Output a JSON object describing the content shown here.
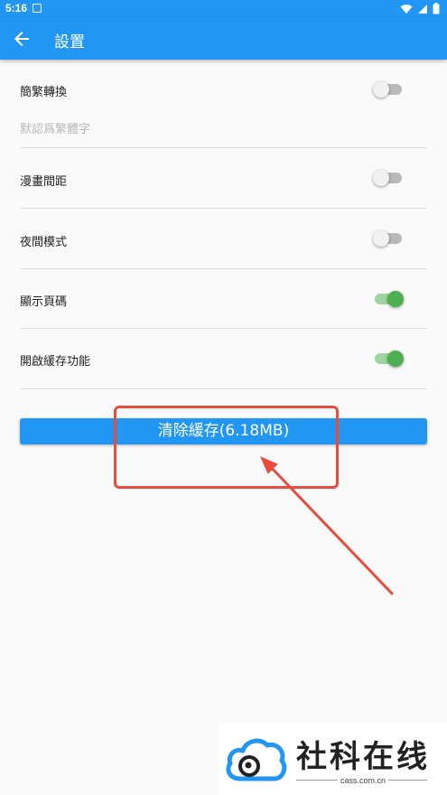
{
  "status_bar": {
    "time": "5:16",
    "icons": [
      "notification-icon",
      "wifi-icon",
      "signal-icon",
      "battery-icon"
    ]
  },
  "app_bar": {
    "title": "設置",
    "back_icon": "arrow-back-icon"
  },
  "settings": [
    {
      "label": "簡繁轉換",
      "hint": "默認爲繁體字",
      "enabled": false
    },
    {
      "label": "漫畫間距",
      "enabled": false
    },
    {
      "label": "夜間模式",
      "enabled": false
    },
    {
      "label": "顯示頁碼",
      "enabled": true
    },
    {
      "label": "開啟緩存功能",
      "enabled": true
    }
  ],
  "clear_cache_button": {
    "label": "清除緩存(6.18MB)"
  },
  "colors": {
    "primary": "#2196f3",
    "switch_on": "#4caf50",
    "annotation": "#e74c3c"
  },
  "watermark": {
    "title": "社科在线",
    "domain": "cass.com.cn"
  }
}
